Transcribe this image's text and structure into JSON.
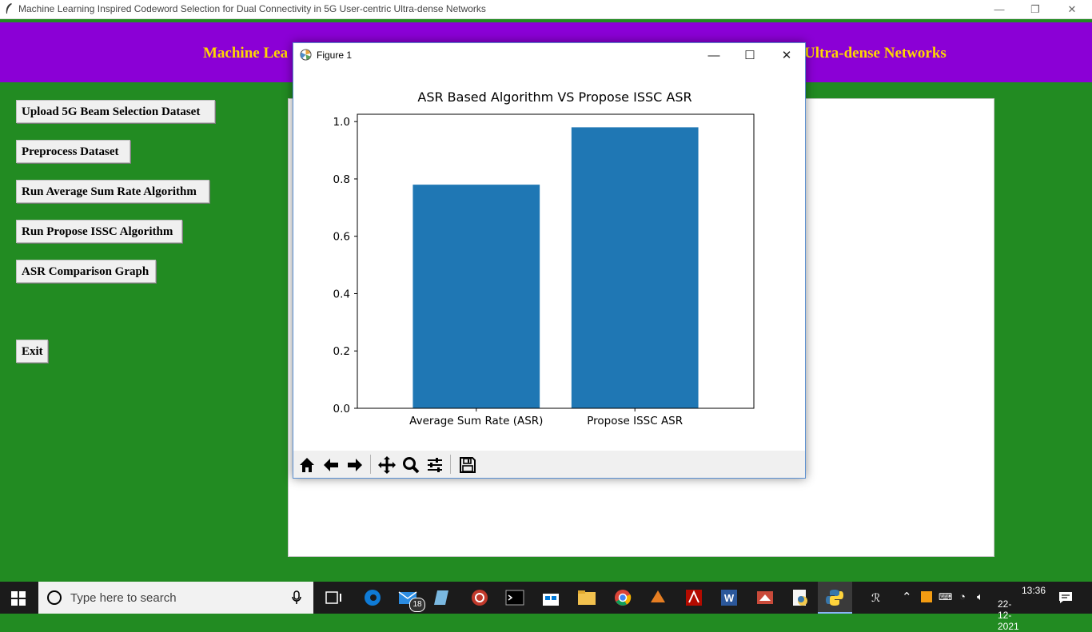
{
  "window": {
    "title": "Machine Learning Inspired Codeword Selection for Dual Connectivity in 5G User-centric Ultra-dense Networks",
    "minimize": "—",
    "restore": "❐",
    "close": "✕"
  },
  "header": {
    "title_left": "Machine Lea",
    "title_right": "Ultra-dense Networks"
  },
  "buttons": [
    {
      "label": "Upload 5G Beam Selection Dataset"
    },
    {
      "label": "Preprocess Dataset"
    },
    {
      "label": "Run Average Sum Rate Algorithm"
    },
    {
      "label": "Run Propose ISSC Algorithm"
    },
    {
      "label": "ASR Comparison Graph"
    },
    {
      "label": "Exit"
    }
  ],
  "figure": {
    "title": "Figure 1",
    "minimize": "—",
    "maximize": "☐",
    "close": "✕",
    "toolbar": [
      "home-icon",
      "back-icon",
      "forward-icon",
      "pan-icon",
      "zoom-icon",
      "configure-icon",
      "save-icon"
    ]
  },
  "chart_data": {
    "type": "bar",
    "title": "ASR Based Algorithm VS Propose ISSC ASR",
    "categories": [
      "Average Sum Rate (ASR)",
      "Propose ISSC ASR"
    ],
    "values": [
      0.78,
      0.98
    ],
    "yticks": [
      "0.0",
      "0.2",
      "0.4",
      "0.6",
      "0.8",
      "1.0"
    ],
    "ylim": [
      0,
      1.0256
    ],
    "bar_color": "#1f77b4",
    "xlabel": "",
    "ylabel": ""
  },
  "taskbar": {
    "search_placeholder": "Type here to search",
    "mail_badge": "18",
    "time": "13:36",
    "date": "22-12-2021"
  },
  "colors": {
    "background": "#228b22",
    "banner": "#8b00d6",
    "banner_text": "#ffd700"
  }
}
